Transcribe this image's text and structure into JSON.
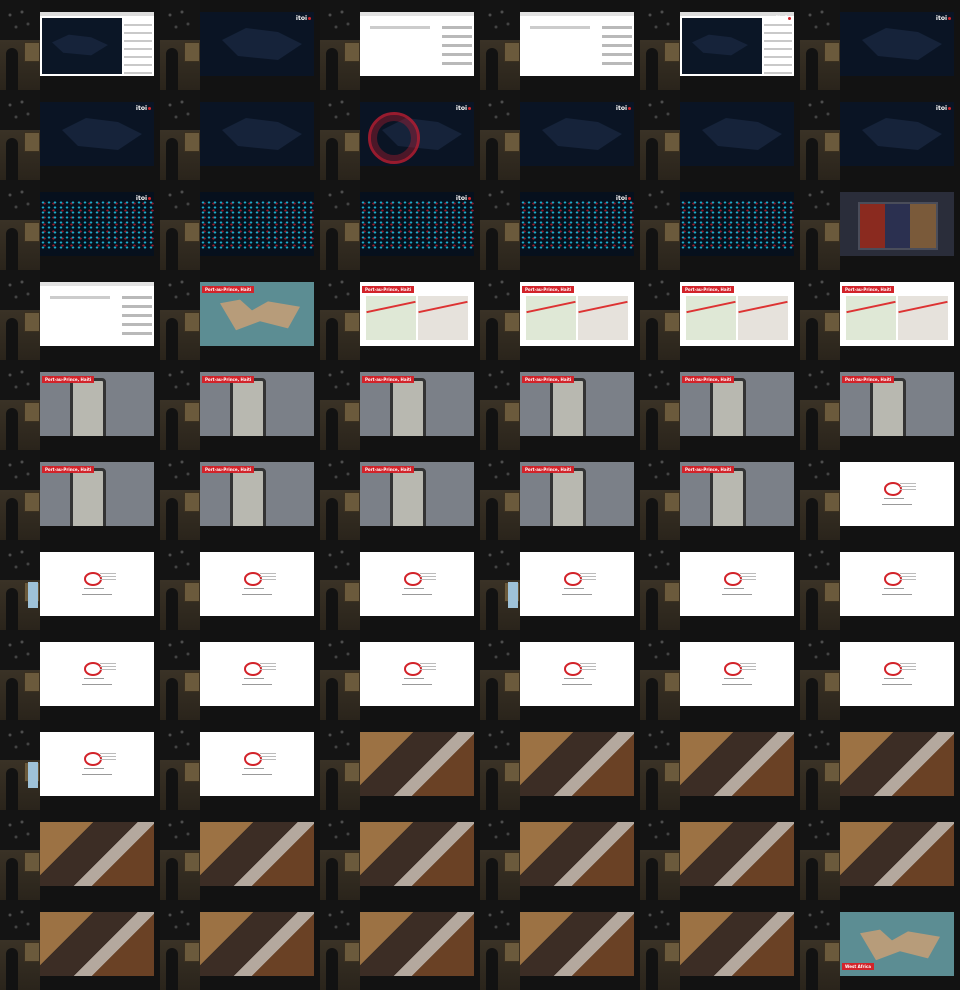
{
  "frames": [
    {
      "t": "s-browser-map",
      "w": false
    },
    {
      "t": "s-map-dark",
      "itoi": true
    },
    {
      "t": "s-browser-white"
    },
    {
      "t": "s-browser-white"
    },
    {
      "t": "s-browser-map",
      "itoi": true
    },
    {
      "t": "s-map-dark",
      "itoi": true
    },
    {
      "t": "s-map-dark",
      "itoi": true
    },
    {
      "t": "s-map-dark"
    },
    {
      "t": "s-map-dark s-map-red",
      "itoi": true
    },
    {
      "t": "s-map-dark",
      "itoi": true
    },
    {
      "t": "s-map-dark"
    },
    {
      "t": "s-map-dark",
      "itoi": true
    },
    {
      "t": "s-map-dots",
      "itoi": true
    },
    {
      "t": "s-map-dots"
    },
    {
      "t": "s-map-dots",
      "itoi": true
    },
    {
      "t": "s-map-dots",
      "itoi": true
    },
    {
      "t": "s-map-dots"
    },
    {
      "t": "s-video-grid"
    },
    {
      "t": "s-browser-white"
    },
    {
      "t": "s-world",
      "label": "Port-au-Prince, Haiti"
    },
    {
      "t": "s-twomaps",
      "label": "Port-au-Prince, Haiti"
    },
    {
      "t": "s-twomaps",
      "label": "Port-au-Prince, Haiti"
    },
    {
      "t": "s-twomaps",
      "label": "Port-au-Prince, Haiti"
    },
    {
      "t": "s-twomaps",
      "label": "Port-au-Prince, Haiti"
    },
    {
      "t": "s-gps",
      "label": "Port-au-Prince, Haiti"
    },
    {
      "t": "s-gps",
      "label": "Port-au-Prince, Haiti"
    },
    {
      "t": "s-gps",
      "label": "Port-au-Prince, Haiti"
    },
    {
      "t": "s-gps",
      "label": "Port-au-Prince, Haiti"
    },
    {
      "t": "s-gps",
      "label": "Port-au-Prince, Haiti"
    },
    {
      "t": "s-gps",
      "label": "Port-au-Prince, Haiti"
    },
    {
      "t": "s-gps",
      "label": "Port-au-Prince, Haiti"
    },
    {
      "t": "s-gps",
      "label": "Port-au-Prince, Haiti"
    },
    {
      "t": "s-gps",
      "label": "Port-au-Prince, Haiti"
    },
    {
      "t": "s-gps",
      "label": "Port-au-Prince, Haiti"
    },
    {
      "t": "s-gps",
      "label": "Port-au-Prince, Haiti"
    },
    {
      "t": "s-logo"
    },
    {
      "t": "s-logo",
      "w": true
    },
    {
      "t": "s-logo"
    },
    {
      "t": "s-logo"
    },
    {
      "t": "s-logo",
      "w": true
    },
    {
      "t": "s-logo"
    },
    {
      "t": "s-logo"
    },
    {
      "t": "s-logo"
    },
    {
      "t": "s-logo"
    },
    {
      "t": "s-logo"
    },
    {
      "t": "s-logo"
    },
    {
      "t": "s-logo"
    },
    {
      "t": "s-logo"
    },
    {
      "t": "s-logo",
      "w": true
    },
    {
      "t": "s-logo"
    },
    {
      "t": "s-room"
    },
    {
      "t": "s-room"
    },
    {
      "t": "s-room"
    },
    {
      "t": "s-room"
    },
    {
      "t": "s-room"
    },
    {
      "t": "s-room"
    },
    {
      "t": "s-room"
    },
    {
      "t": "s-room"
    },
    {
      "t": "s-room"
    },
    {
      "t": "s-room"
    },
    {
      "t": "s-room"
    },
    {
      "t": "s-room"
    },
    {
      "t": "s-room"
    },
    {
      "t": "s-room"
    },
    {
      "t": "s-room"
    },
    {
      "t": "s-world",
      "labelBottom": "West Africa"
    }
  ],
  "brand": {
    "itoi_text": "itoi",
    "accent": "#d2232a"
  }
}
